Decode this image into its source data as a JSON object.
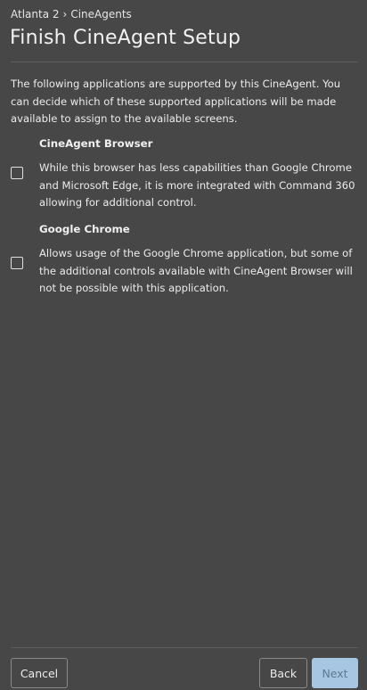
{
  "breadcrumb": {
    "parent": "Atlanta 2",
    "separator": "›",
    "current": "CineAgents"
  },
  "page": {
    "title": "Finish CineAgent Setup",
    "intro": "The following applications are supported by this CineAgent. You can decide which of these supported applications will be made available to assign to the available screens."
  },
  "options": [
    {
      "title": "CineAgent Browser",
      "description": "While this browser has less capabilities than Google Chrome and Microsoft Edge, it is more integrated with Command 360 allowing for additional control.",
      "checked": false
    },
    {
      "title": "Google Chrome",
      "description": "Allows usage of the Google Chrome application, but some of the additional controls available with CineAgent Browser will not be possible with this application.",
      "checked": false
    }
  ],
  "footer": {
    "cancel_label": "Cancel",
    "back_label": "Back",
    "next_label": "Next"
  },
  "colors": {
    "background": "#474747",
    "primary_button": "#a7c6e2",
    "primary_button_text": "#5e7891"
  }
}
